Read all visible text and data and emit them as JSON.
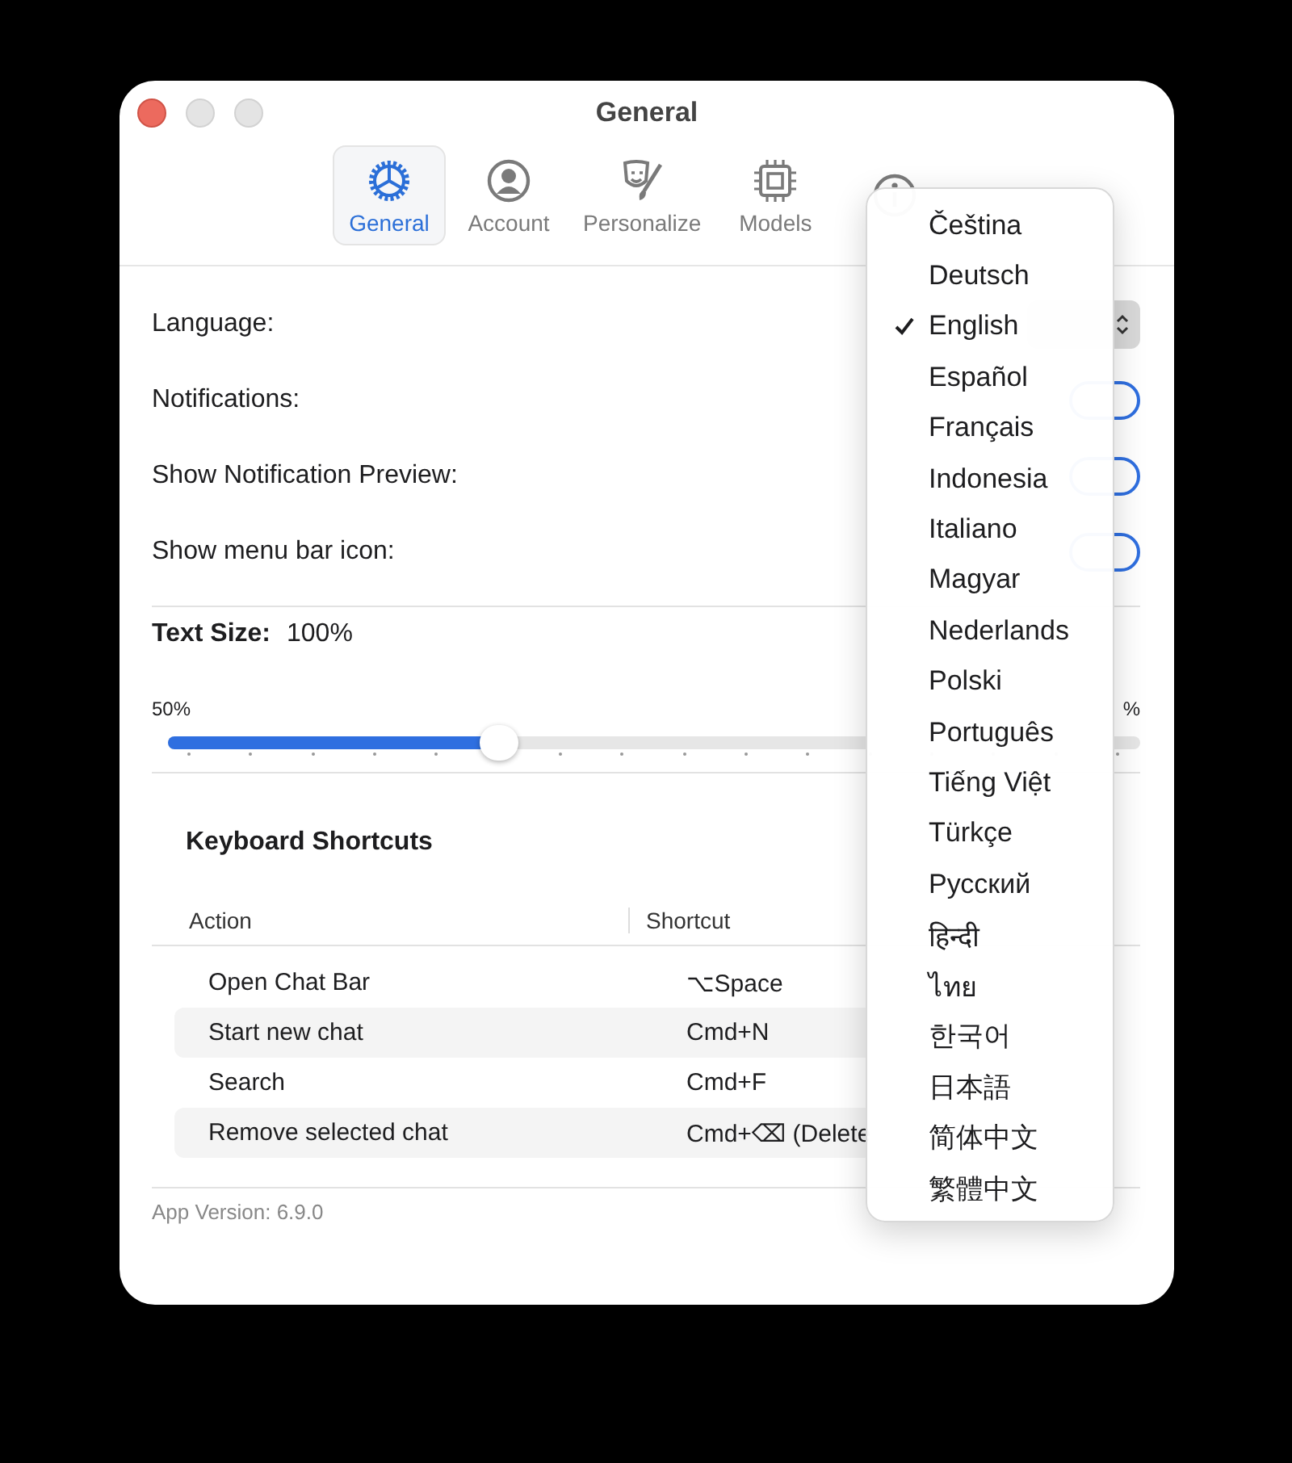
{
  "window": {
    "title": "General"
  },
  "tabs": [
    {
      "label": "General",
      "selected": true
    },
    {
      "label": "Account",
      "selected": false
    },
    {
      "label": "Personalize",
      "selected": false
    },
    {
      "label": "Models",
      "selected": false
    },
    {
      "selected": false
    }
  ],
  "settings": [
    {
      "label": "Language:",
      "kind": "popup"
    },
    {
      "label": "Notifications:",
      "kind": "toggle",
      "on": true
    },
    {
      "label": "Show Notification Preview:",
      "kind": "toggle",
      "on": true
    },
    {
      "label": "Show menu bar icon:",
      "kind": "toggle",
      "on": true
    }
  ],
  "text_size": {
    "label": "Text Size:",
    "value": "100%",
    "min_label": "50%",
    "max_label": "%",
    "level": 0.34
  },
  "shortcuts": {
    "title": "Keyboard Shortcuts",
    "columns": [
      "Action",
      "Shortcut"
    ],
    "rows": [
      {
        "action": "Open Chat Bar",
        "shortcut": "⌥Space"
      },
      {
        "action": "Start new chat",
        "shortcut": "Cmd+N"
      },
      {
        "action": "Search",
        "shortcut": "Cmd+F"
      },
      {
        "action": "Remove selected chat",
        "shortcut": "Cmd+⌫ (Delete"
      }
    ]
  },
  "footer": "App Version: 6.9.0",
  "language_menu": [
    {
      "label": "Čeština",
      "selected": false
    },
    {
      "label": "Deutsch",
      "selected": false
    },
    {
      "label": "English",
      "selected": true
    },
    {
      "label": "Español",
      "selected": false
    },
    {
      "label": "Français",
      "selected": false
    },
    {
      "label": "Indonesia",
      "selected": false
    },
    {
      "label": "Italiano",
      "selected": false
    },
    {
      "label": "Magyar",
      "selected": false
    },
    {
      "label": "Nederlands",
      "selected": false
    },
    {
      "label": "Polski",
      "selected": false
    },
    {
      "label": "Português",
      "selected": false
    },
    {
      "label": "Tiếng Việt",
      "selected": false
    },
    {
      "label": "Türkçe",
      "selected": false
    },
    {
      "label": "Русский",
      "selected": false
    },
    {
      "label": "हिन्दी",
      "selected": false
    },
    {
      "label": "ไทย",
      "selected": false
    },
    {
      "label": "한국어",
      "selected": false
    },
    {
      "label": "日本語",
      "selected": false
    },
    {
      "label": "简体中文",
      "selected": false
    },
    {
      "label": "繁體中文",
      "selected": false
    }
  ]
}
